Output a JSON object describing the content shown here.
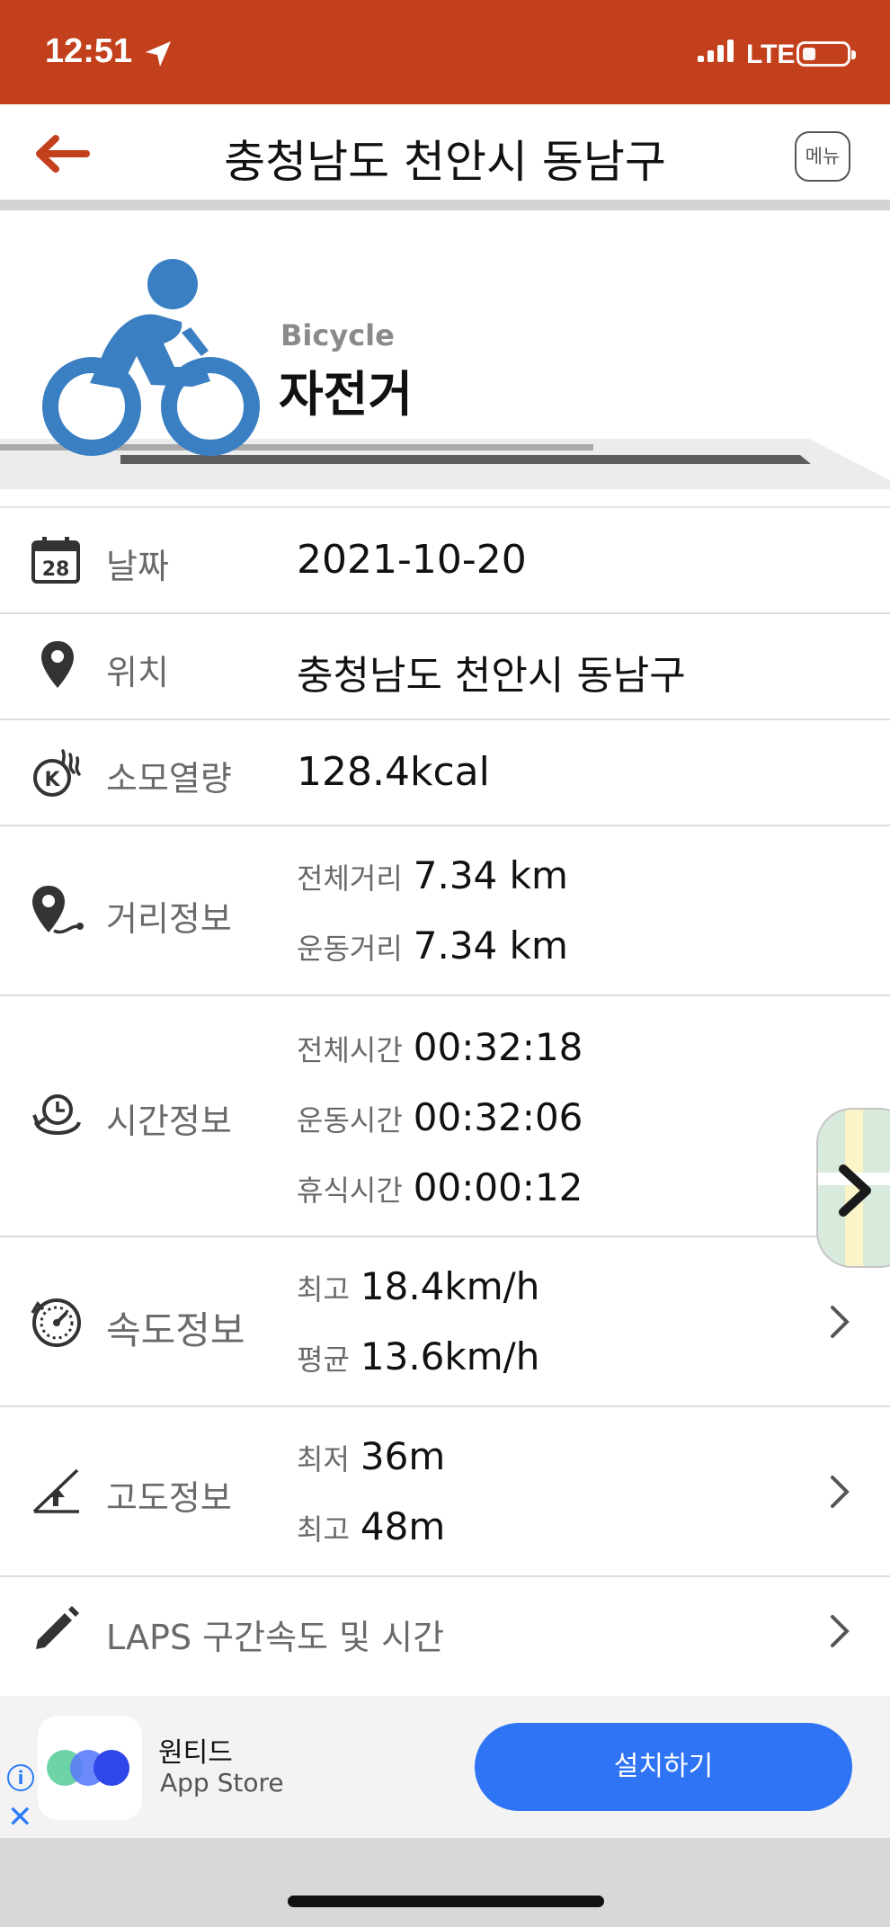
{
  "status_bar": {
    "time": "12:51",
    "network": "LTE",
    "background_color": "#c3401d"
  },
  "nav": {
    "title": "충청남도 천안시 동남구",
    "menu_label": "메뉴",
    "back_icon": "back-arrow-icon",
    "accent_color": "#c3401d"
  },
  "activity": {
    "type_en": "Bicycle",
    "type_ko": "자전거",
    "icon": "bicycle-rider-icon",
    "icon_color": "#3a7fc2"
  },
  "details": {
    "date": {
      "label": "날짜",
      "value": "2021-10-20",
      "icon_text": "28"
    },
    "location": {
      "label": "위치",
      "value": "충청남도 천안시 동남구"
    },
    "calories": {
      "label": "소모열량",
      "value": "128.4kcal"
    },
    "distance": {
      "label": "거리정보",
      "total_label": "전체거리",
      "total_value": "7.34 km",
      "exercise_label": "운동거리",
      "exercise_value": "7.34 km"
    },
    "time": {
      "label": "시간정보",
      "total_label": "전체시간",
      "total_value": "00:32:18",
      "exercise_label": "운동시간",
      "exercise_value": "00:32:06",
      "rest_label": "휴식시간",
      "rest_value": "00:00:12"
    },
    "speed": {
      "label": "속도정보",
      "max_label": "최고",
      "max_value": "18.4km/h",
      "avg_label": "평균",
      "avg_value": "13.6km/h"
    },
    "altitude": {
      "label": "고도정보",
      "min_label": "최저",
      "min_value": "36m",
      "max_label": "최고",
      "max_value": "48m"
    },
    "laps": {
      "label": "LAPS 구간속도 및 시간"
    }
  },
  "ad": {
    "app_name": "원티드",
    "store": "App Store",
    "button_label": "설치하기",
    "button_color": "#2f74f5"
  }
}
